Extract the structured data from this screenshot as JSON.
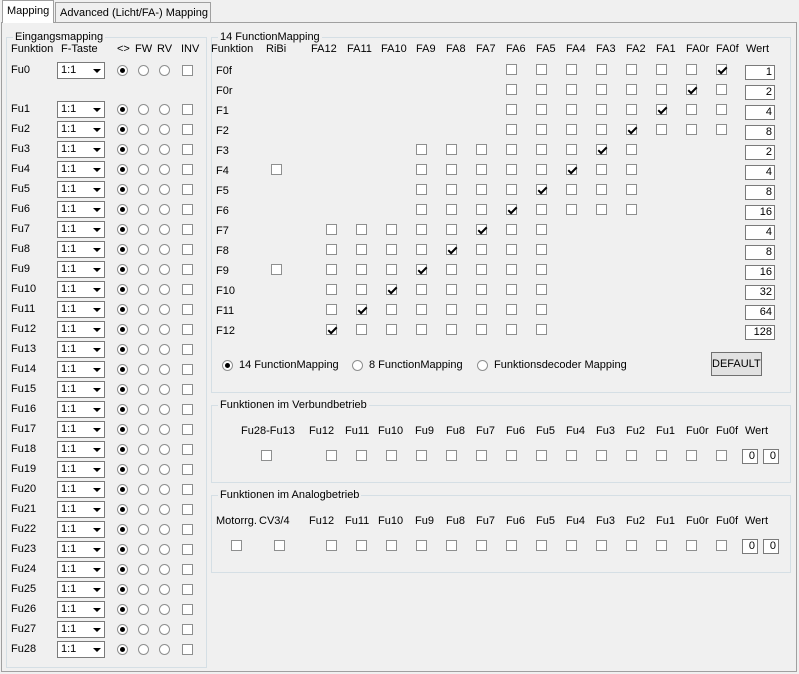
{
  "tabs": [
    {
      "label": "Mapping",
      "active": true
    },
    {
      "label": "Advanced (Licht/FA-) Mapping",
      "active": false
    }
  ],
  "input_mapping": {
    "legend": "Eingangsmapping",
    "headers": {
      "funktion": "Funktion",
      "ftaste": "F-Taste",
      "both": "<>",
      "fw": "FW",
      "rv": "RV",
      "inv": "INV"
    },
    "rows": [
      {
        "label": "Fu0",
        "value": "1:1",
        "direction": "both",
        "inv": false
      },
      {
        "label": "Fu1",
        "value": "1:1",
        "direction": "both",
        "inv": false
      },
      {
        "label": "Fu2",
        "value": "1:1",
        "direction": "both",
        "inv": false
      },
      {
        "label": "Fu3",
        "value": "1:1",
        "direction": "both",
        "inv": false
      },
      {
        "label": "Fu4",
        "value": "1:1",
        "direction": "both",
        "inv": false
      },
      {
        "label": "Fu5",
        "value": "1:1",
        "direction": "both",
        "inv": false
      },
      {
        "label": "Fu6",
        "value": "1:1",
        "direction": "both",
        "inv": false
      },
      {
        "label": "Fu7",
        "value": "1:1",
        "direction": "both",
        "inv": false
      },
      {
        "label": "Fu8",
        "value": "1:1",
        "direction": "both",
        "inv": false
      },
      {
        "label": "Fu9",
        "value": "1:1",
        "direction": "both",
        "inv": false
      },
      {
        "label": "Fu10",
        "value": "1:1",
        "direction": "both",
        "inv": false
      },
      {
        "label": "Fu11",
        "value": "1:1",
        "direction": "both",
        "inv": false
      },
      {
        "label": "Fu12",
        "value": "1:1",
        "direction": "both",
        "inv": false
      },
      {
        "label": "Fu13",
        "value": "1:1",
        "direction": "both",
        "inv": false
      },
      {
        "label": "Fu14",
        "value": "1:1",
        "direction": "both",
        "inv": false
      },
      {
        "label": "Fu15",
        "value": "1:1",
        "direction": "both",
        "inv": false
      },
      {
        "label": "Fu16",
        "value": "1:1",
        "direction": "both",
        "inv": false
      },
      {
        "label": "Fu17",
        "value": "1:1",
        "direction": "both",
        "inv": false
      },
      {
        "label": "Fu18",
        "value": "1:1",
        "direction": "both",
        "inv": false
      },
      {
        "label": "Fu19",
        "value": "1:1",
        "direction": "both",
        "inv": false
      },
      {
        "label": "Fu20",
        "value": "1:1",
        "direction": "both",
        "inv": false
      },
      {
        "label": "Fu21",
        "value": "1:1",
        "direction": "both",
        "inv": false
      },
      {
        "label": "Fu22",
        "value": "1:1",
        "direction": "both",
        "inv": false
      },
      {
        "label": "Fu23",
        "value": "1:1",
        "direction": "both",
        "inv": false
      },
      {
        "label": "Fu24",
        "value": "1:1",
        "direction": "both",
        "inv": false
      },
      {
        "label": "Fu25",
        "value": "1:1",
        "direction": "both",
        "inv": false
      },
      {
        "label": "Fu26",
        "value": "1:1",
        "direction": "both",
        "inv": false
      },
      {
        "label": "Fu27",
        "value": "1:1",
        "direction": "both",
        "inv": false
      },
      {
        "label": "Fu28",
        "value": "1:1",
        "direction": "both",
        "inv": false
      }
    ]
  },
  "function_mapping": {
    "legend": "14 FunctionMapping",
    "columns": [
      "Funktion",
      "RiBi",
      "FA12",
      "FA11",
      "FA10",
      "FA9",
      "FA8",
      "FA7",
      "FA6",
      "FA5",
      "FA4",
      "FA3",
      "FA2",
      "FA1",
      "FA0r",
      "FA0f",
      "Wert"
    ],
    "rows": [
      {
        "label": "F0f",
        "cells": [
          null,
          null,
          null,
          null,
          null,
          null,
          null,
          false,
          false,
          false,
          false,
          false,
          false,
          false,
          true
        ],
        "wert": "1"
      },
      {
        "label": "F0r",
        "cells": [
          null,
          null,
          null,
          null,
          null,
          null,
          null,
          false,
          false,
          false,
          false,
          false,
          false,
          true,
          false
        ],
        "wert": "2"
      },
      {
        "label": "F1",
        "cells": [
          null,
          null,
          null,
          null,
          null,
          null,
          null,
          false,
          false,
          false,
          false,
          false,
          true,
          false,
          false
        ],
        "wert": "4"
      },
      {
        "label": "F2",
        "cells": [
          null,
          null,
          null,
          null,
          null,
          null,
          null,
          false,
          false,
          false,
          false,
          true,
          false,
          false,
          false
        ],
        "wert": "8"
      },
      {
        "label": "F3",
        "cells": [
          null,
          null,
          null,
          null,
          false,
          false,
          false,
          false,
          false,
          false,
          true,
          false,
          null,
          null,
          null
        ],
        "wert": "2"
      },
      {
        "label": "F4",
        "cells": [
          false,
          null,
          null,
          null,
          false,
          false,
          false,
          false,
          false,
          true,
          false,
          false,
          null,
          null,
          null
        ],
        "wert": "4"
      },
      {
        "label": "F5",
        "cells": [
          null,
          null,
          null,
          null,
          false,
          false,
          false,
          false,
          true,
          false,
          false,
          false,
          null,
          null,
          null
        ],
        "wert": "8"
      },
      {
        "label": "F6",
        "cells": [
          null,
          null,
          null,
          null,
          false,
          false,
          false,
          true,
          false,
          false,
          false,
          false,
          null,
          null,
          null
        ],
        "wert": "16"
      },
      {
        "label": "F7",
        "cells": [
          null,
          false,
          false,
          false,
          false,
          false,
          true,
          false,
          false,
          null,
          null,
          null,
          null,
          null,
          null
        ],
        "wert": "4"
      },
      {
        "label": "F8",
        "cells": [
          null,
          false,
          false,
          false,
          false,
          true,
          false,
          false,
          false,
          null,
          null,
          null,
          null,
          null,
          null
        ],
        "wert": "8"
      },
      {
        "label": "F9",
        "cells": [
          false,
          false,
          false,
          false,
          true,
          false,
          false,
          false,
          false,
          null,
          null,
          null,
          null,
          null,
          null
        ],
        "wert": "16"
      },
      {
        "label": "F10",
        "cells": [
          null,
          false,
          false,
          true,
          false,
          false,
          false,
          false,
          false,
          null,
          null,
          null,
          null,
          null,
          null
        ],
        "wert": "32"
      },
      {
        "label": "F11",
        "cells": [
          null,
          false,
          true,
          false,
          false,
          false,
          false,
          false,
          false,
          null,
          null,
          null,
          null,
          null,
          null
        ],
        "wert": "64"
      },
      {
        "label": "F12",
        "cells": [
          null,
          true,
          false,
          false,
          false,
          false,
          false,
          false,
          false,
          null,
          null,
          null,
          null,
          null,
          null
        ],
        "wert": "128"
      }
    ],
    "modes": [
      {
        "label": "14 FunctionMapping",
        "selected": true
      },
      {
        "label": "8 FunctionMapping",
        "selected": false
      },
      {
        "label": "Funktionsdecoder Mapping",
        "selected": false
      }
    ],
    "default_button": "DEFAULT"
  },
  "verbund": {
    "legend": "Funktionen im Verbundbetrieb",
    "headers": [
      "Fu28-Fu13",
      "Fu12",
      "Fu11",
      "Fu10",
      "Fu9",
      "Fu8",
      "Fu7",
      "Fu6",
      "Fu5",
      "Fu4",
      "Fu3",
      "Fu2",
      "Fu1",
      "Fu0r",
      "Fu0f"
    ],
    "wert_label": "Wert",
    "values": [
      "0",
      "0"
    ]
  },
  "analog": {
    "legend": "Funktionen im Analogbetrieb",
    "headers": [
      "Motorrg.",
      "CV3/4",
      "Fu12",
      "Fu11",
      "Fu10",
      "Fu9",
      "Fu8",
      "Fu7",
      "Fu6",
      "Fu5",
      "Fu4",
      "Fu3",
      "Fu2",
      "Fu1",
      "Fu0r",
      "Fu0f"
    ],
    "wert_label": "Wert",
    "values": [
      "0",
      "0"
    ]
  }
}
